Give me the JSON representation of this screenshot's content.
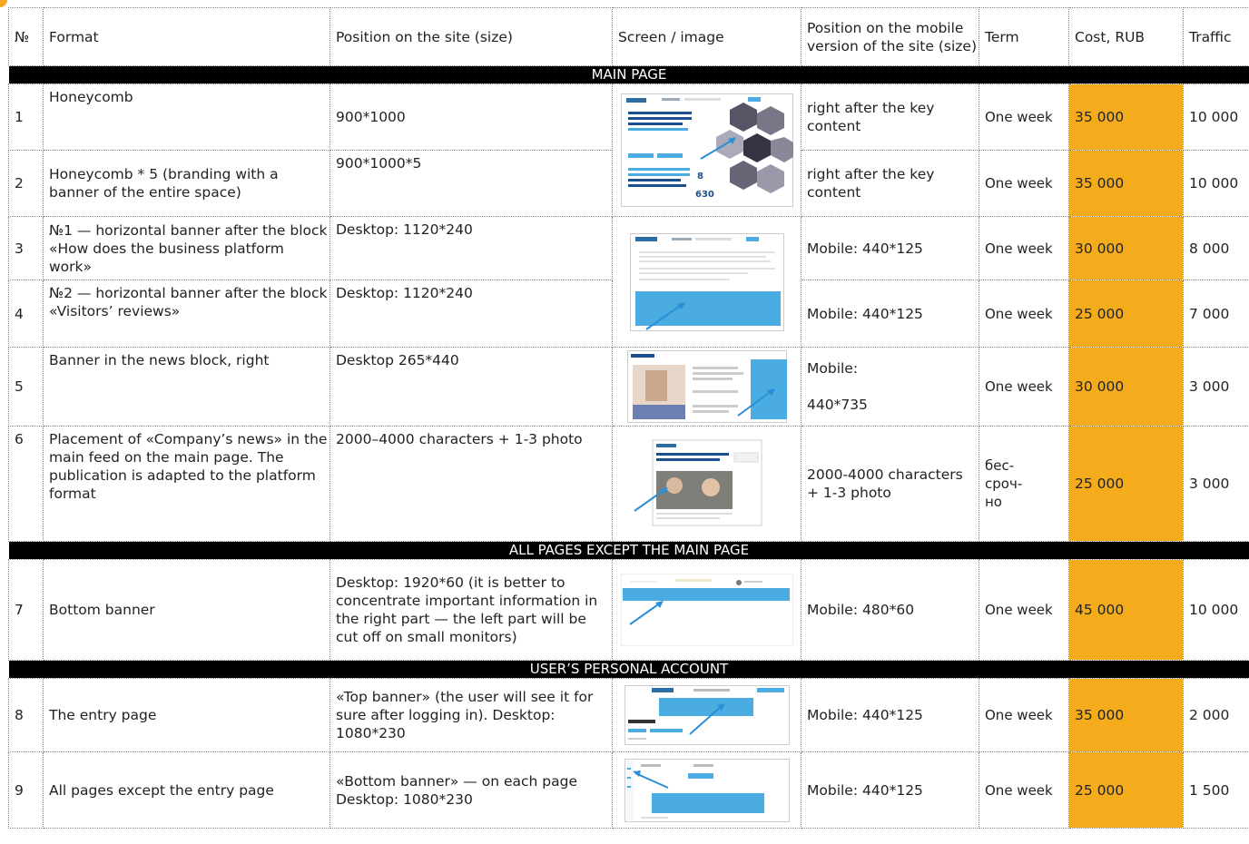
{
  "headers": [
    "№",
    "Format",
    "Position on the site (size)",
    "Screen / image",
    "Position on the mobile version of the site (size)",
    "Term",
    "Cost, RUB",
    "Traffic"
  ],
  "sections": {
    "main": "MAIN PAGE",
    "all": "ALL PAGES EXCEPT THE MAIN PAGE",
    "account": "USER’S PERSONAL ACCOUNT"
  },
  "rows": [
    {
      "n": "1",
      "format": "Honeycomb",
      "position": "900*1000",
      "mobile": "right after the key content",
      "term": "One week",
      "cost": "35 000",
      "traffic": "10 000"
    },
    {
      "n": "2",
      "format": "Honeycomb * 5 (branding with a banner of the entire space)",
      "position": "900*1000*5",
      "mobile": "right after the key content",
      "term": "One week",
      "cost": "35 000",
      "traffic": "10 000"
    },
    {
      "n": "3",
      "format": "№1 — horizontal banner after the block «How does the business platform work»",
      "position": "Desktop: 1120*240",
      "mobile": "Mobile: 440*125",
      "term": "One week",
      "cost": "30 000",
      "traffic": "8 000"
    },
    {
      "n": "4",
      "format": "№2 — horizontal banner after the block «Visitors’ reviews»",
      "position": "Desktop: 1120*240",
      "mobile": "Mobile: 440*125",
      "term": "One week",
      "cost": "25 000",
      "traffic": "7 000"
    },
    {
      "n": "5",
      "format": "Banner in the news block, right",
      "position": "Desktop 265*440",
      "mobile_a": "Mobile:",
      "mobile_b": "440*735",
      "term": "One week",
      "cost": "30 000",
      "traffic": "3 000"
    },
    {
      "n": "6",
      "format": "Placement of «Company’s news» in the main feed on the main page. The publication is adapted to the platform format",
      "position": "2000–4000 characters + 1-3 photo",
      "mobile": "2000-4000 characters + 1-3 photo",
      "term": "бес-сроч-но",
      "cost": "25 000",
      "traffic": "3 000"
    },
    {
      "n": "7",
      "format": "Bottom banner",
      "position": "Desktop: 1920*60 (it is better to concentrate important information in the right part — the left part will be cut off on small monitors)",
      "mobile": "Mobile: 480*60",
      "term": "One week",
      "cost": "45 000",
      "traffic": "10 000"
    },
    {
      "n": "8",
      "format": "The entry page",
      "position": "«Top banner» (the user will see it for sure after logging in). Desktop: 1080*230",
      "mobile": "Mobile: 440*125",
      "term": "One week",
      "cost": "35 000",
      "traffic": "2 000"
    },
    {
      "n": "9",
      "format": "All pages except the entry page",
      "position": "«Bottom banner» — on each page Desktop: 1080*230",
      "mobile": "Mobile: 440*125",
      "term": "One week",
      "cost": "25 000",
      "traffic": "1 500"
    }
  ],
  "colors": {
    "cost_highlight": "#f5ac1c",
    "banner_blue": "#4aace0",
    "section_bg": "#000000"
  }
}
